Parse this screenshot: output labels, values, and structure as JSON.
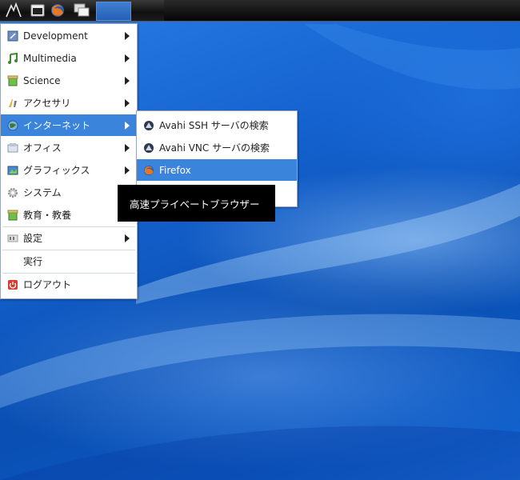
{
  "main_menu": {
    "items": [
      {
        "label": "Development"
      },
      {
        "label": "Multimedia"
      },
      {
        "label": "Science"
      },
      {
        "label": "アクセサリ"
      },
      {
        "label": "インターネット"
      },
      {
        "label": "オフィス"
      },
      {
        "label": "グラフィックス"
      },
      {
        "label": "システム"
      },
      {
        "label": "教育・教養"
      },
      {
        "label": "設定"
      },
      {
        "label": "実行"
      },
      {
        "label": "ログアウト"
      }
    ]
  },
  "internet_submenu": {
    "items": [
      {
        "label": "Avahi SSH サーバの検索"
      },
      {
        "label": "Avahi VNC サーバの検索"
      },
      {
        "label": "Firefox"
      }
    ]
  },
  "tooltip": {
    "text": "高速プライベートブラウザー"
  },
  "colors": {
    "selection": "#3a84dc",
    "desktop": "#0d55b8",
    "panel": "#111111"
  }
}
